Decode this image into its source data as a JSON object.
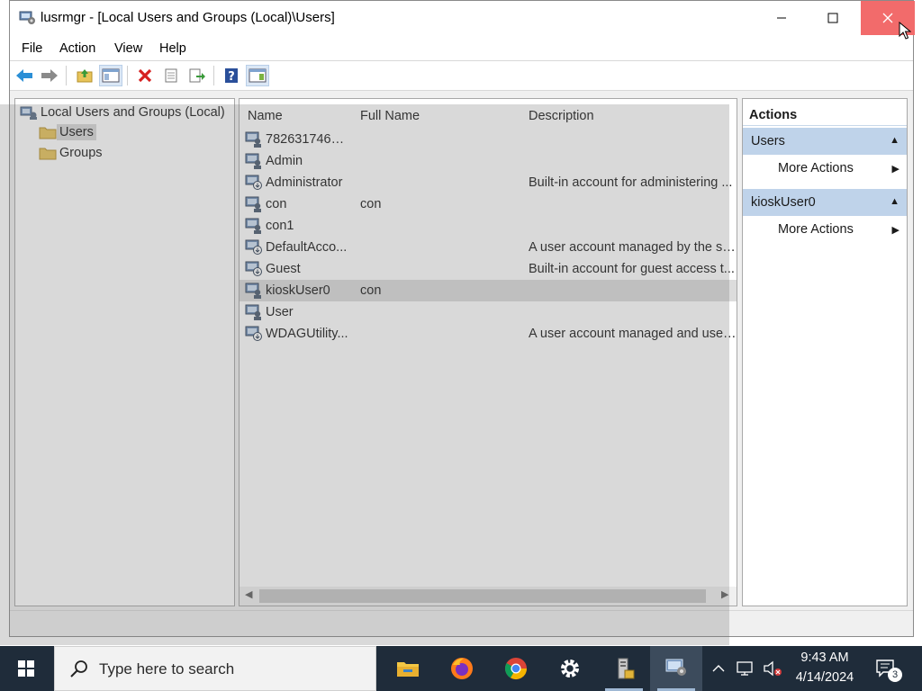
{
  "window": {
    "title": "lusrmgr - [Local Users and Groups (Local)\\Users]",
    "controls": {
      "minimize": "—",
      "maximize": "☐",
      "close": "✕"
    }
  },
  "menu": {
    "file": "File",
    "action": "Action",
    "view": "View",
    "help": "Help"
  },
  "toolbar": {
    "buttons": [
      "back-icon",
      "forward-icon",
      "up-folder-icon",
      "show-hide-console-tree-icon",
      "delete-icon",
      "properties-icon",
      "export-list-icon",
      "help-icon",
      "show-hide-action-pane-icon"
    ]
  },
  "tree": {
    "root": "Local Users and Groups (Local)",
    "users": "Users",
    "groups": "Groups"
  },
  "list": {
    "columns": {
      "name": "Name",
      "full_name": "Full Name",
      "description": "Description"
    },
    "rows": [
      {
        "name": "78263174647...",
        "full_name": "",
        "description": ""
      },
      {
        "name": "Admin",
        "full_name": "",
        "description": ""
      },
      {
        "name": "Administrator",
        "full_name": "",
        "description": "Built-in account for administering ..."
      },
      {
        "name": "con",
        "full_name": "con",
        "description": ""
      },
      {
        "name": "con1",
        "full_name": "",
        "description": ""
      },
      {
        "name": "DefaultAcco...",
        "full_name": "",
        "description": "A user account managed by the sy..."
      },
      {
        "name": "Guest",
        "full_name": "",
        "description": "Built-in account for guest access t..."
      },
      {
        "name": "kioskUser0",
        "full_name": "con",
        "description": ""
      },
      {
        "name": "User",
        "full_name": "",
        "description": ""
      },
      {
        "name": "WDAGUtility...",
        "full_name": "",
        "description": "A user account managed and used..."
      }
    ],
    "selected_row": "kioskUser0"
  },
  "actions": {
    "title": "Actions",
    "section1": {
      "label": "Users",
      "item": "More Actions"
    },
    "section2": {
      "label": "kioskUser0",
      "item": "More Actions"
    }
  },
  "taskbar": {
    "search_placeholder": "Type here to search",
    "apps": [
      "file-explorer-icon",
      "firefox-icon",
      "chrome-icon",
      "settings-icon",
      "server-manager-icon",
      "computer-management-icon"
    ],
    "clock": {
      "time": "9:43 AM",
      "date": "4/14/2024"
    },
    "notification_count": "3"
  },
  "colors": {
    "close_hover": "#f26b6b",
    "actions_header": "#bfd3ea",
    "taskbar": "#1f2c3a",
    "selection": "#dcdcdc"
  }
}
